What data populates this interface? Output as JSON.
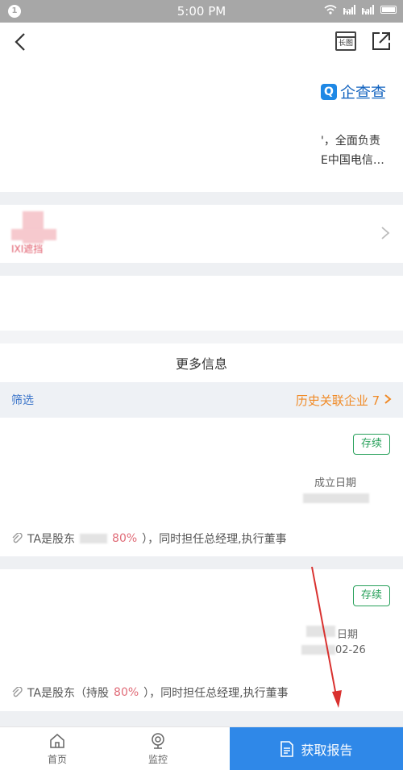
{
  "status_bar": {
    "time": "5:00 PM",
    "notification_count": "1",
    "network_1": "4G",
    "network_2": "4G"
  },
  "toolbar": {
    "long_image_label": "长图"
  },
  "brand": {
    "logo_glyph": "Q",
    "name": "企查查"
  },
  "intro": {
    "line1": "'，全面负责",
    "line2": "E中国电信…"
  },
  "blurred_name": "IXI遮挡",
  "section": {
    "title": "更多信息"
  },
  "filter": {
    "label": "筛选",
    "history_label": "历史关联企业 7"
  },
  "cards": [
    {
      "status": "存续",
      "date_label": "成立日期",
      "relation_prefix": "TA是股东",
      "relation_pct": "80%",
      "relation_suffix": "），同时担任总经理,执行董事"
    },
    {
      "status": "存续",
      "date_label": "日期",
      "date_value": "02-26",
      "relation_prefix": "TA是股东（持股",
      "relation_pct": "80%",
      "relation_suffix": "），同时担任总经理,执行董事"
    }
  ],
  "tabs": [
    {
      "label": "首页",
      "icon": "home-icon"
    },
    {
      "label": "监控",
      "icon": "camera-icon"
    }
  ],
  "report_button": {
    "label": "获取报告",
    "icon": "document-icon"
  },
  "colors": {
    "accent": "#2f88e8",
    "orange": "#f08a26",
    "green": "#27a05a",
    "pink": "#e06c78",
    "arrow": "#d9312f"
  }
}
